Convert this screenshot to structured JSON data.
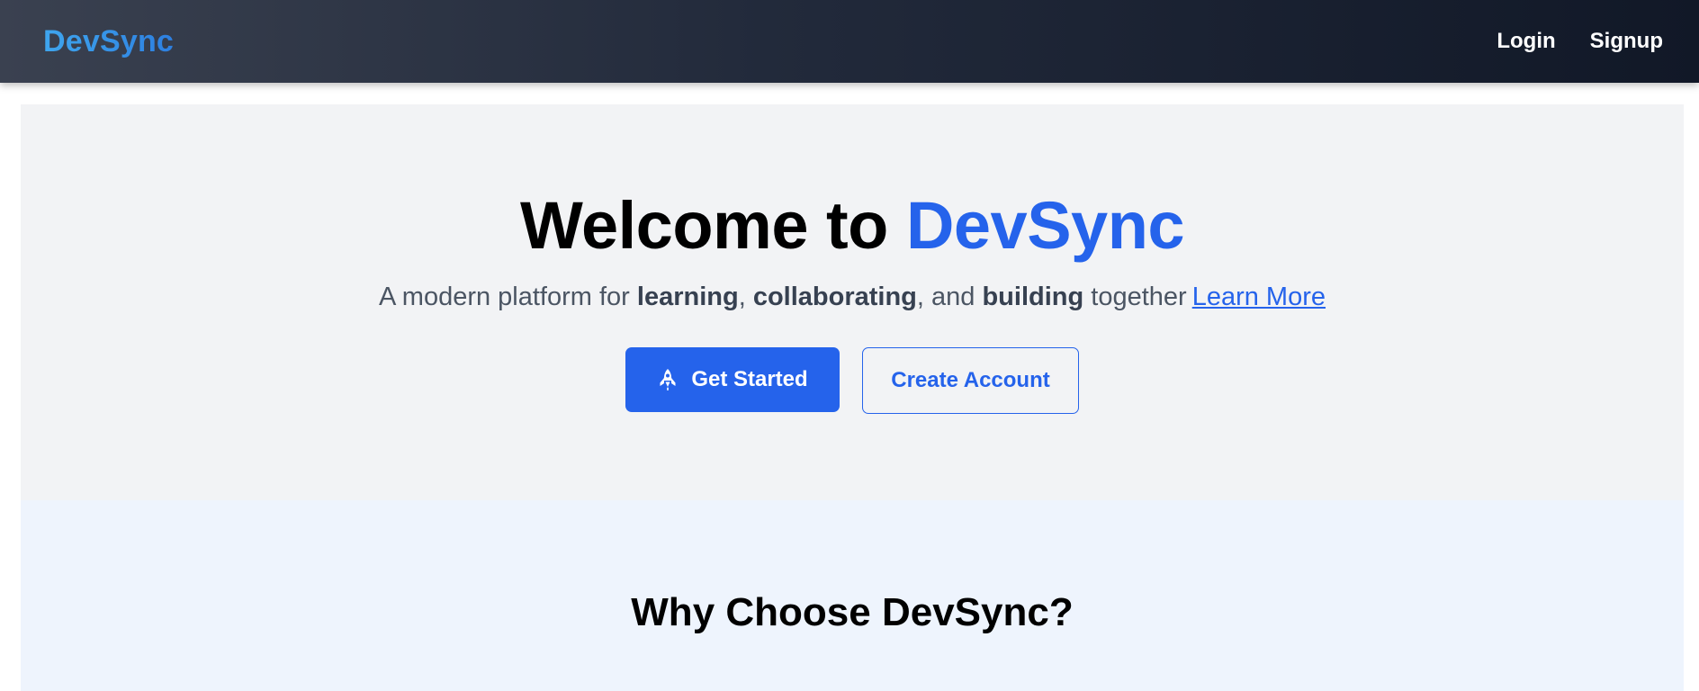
{
  "nav": {
    "brand": "DevSync",
    "links": [
      {
        "label": "Login"
      },
      {
        "label": "Signup"
      }
    ]
  },
  "hero": {
    "title_prefix": "Welcome to ",
    "title_accent": "DevSync",
    "subtitle": {
      "part1": "A modern platform for ",
      "bold1": "learning",
      "part2": ", ",
      "bold2": "collaborating",
      "part3": ", and ",
      "bold3": "building",
      "part4": " together",
      "link": "Learn More"
    },
    "primary_button": {
      "label": "Get Started",
      "icon": "rocket-icon"
    },
    "secondary_button": {
      "label": "Create Account"
    }
  },
  "features": {
    "title": "Why Choose DevSync?"
  },
  "colors": {
    "accent": "#2563eb",
    "brand": "#3b9ae8",
    "hero_bg": "#f2f3f5",
    "features_bg": "#eef4fd",
    "navbar_dark": "#111827"
  }
}
